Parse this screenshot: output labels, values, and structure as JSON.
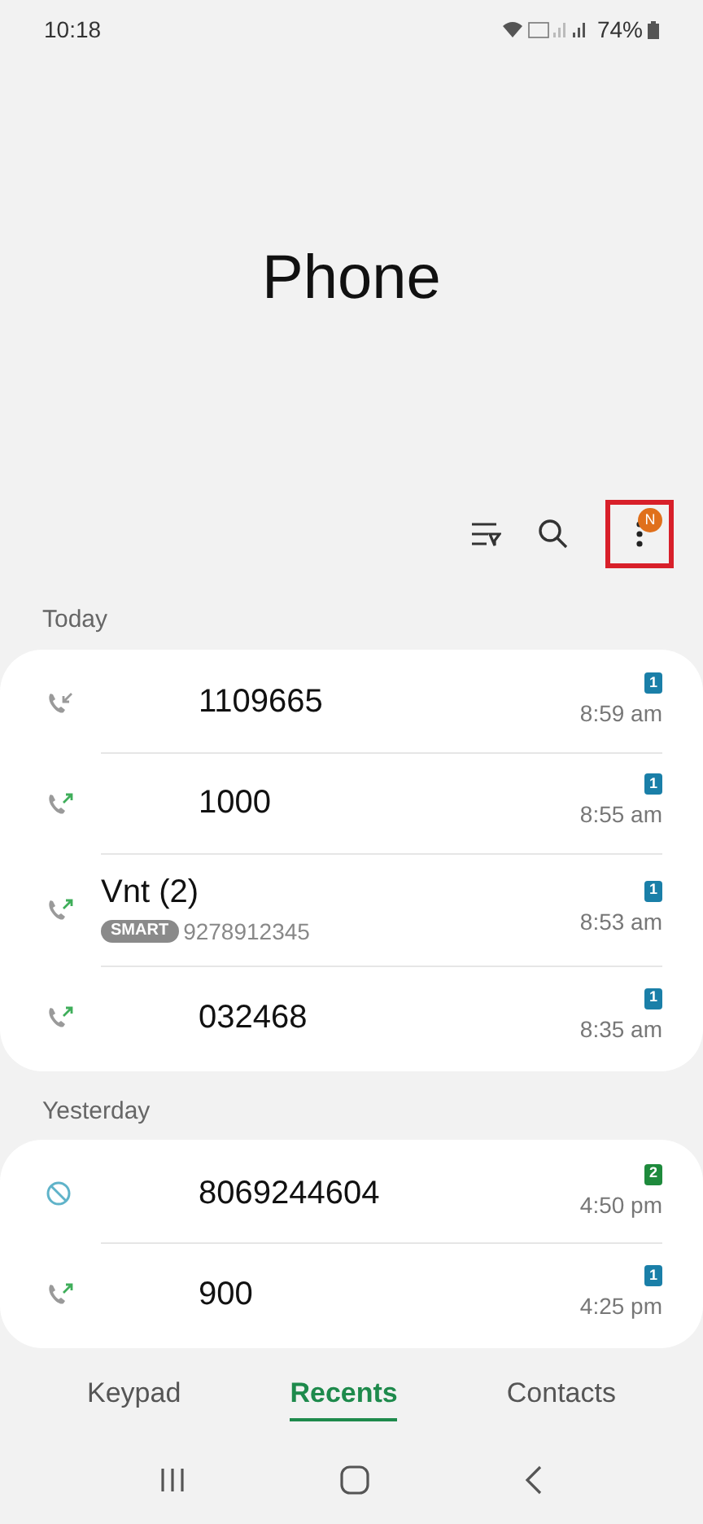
{
  "status_bar": {
    "time": "10:18",
    "battery": "74%"
  },
  "title": "Phone",
  "toolbar": {
    "more_badge": "N"
  },
  "sections": [
    {
      "label": "Today",
      "calls": [
        {
          "kind": "incoming",
          "number": "1109665",
          "sim": "1",
          "color": "#1a7fa8",
          "time": "8:59 am"
        },
        {
          "kind": "outgoing",
          "number": "1000",
          "sim": "1",
          "color": "#1a7fa8",
          "time": "8:55 am"
        },
        {
          "kind": "outgoing",
          "number": "Vnt (2)",
          "tag": "SMART",
          "detail": "9278912345",
          "sim": "1",
          "color": "#1a7fa8",
          "time": "8:53 am"
        },
        {
          "kind": "outgoing",
          "number": "032468",
          "sim": "1",
          "color": "#1a7fa8",
          "time": "8:35 am"
        }
      ]
    },
    {
      "label": "Yesterday",
      "calls": [
        {
          "kind": "blocked",
          "number": "8069244604",
          "sim": "2",
          "color": "#1e8a3c",
          "time": "4:50 pm"
        },
        {
          "kind": "outgoing",
          "number": "900",
          "sim": "1",
          "color": "#1a7fa8",
          "time": "4:25 pm"
        }
      ]
    }
  ],
  "tabs": [
    {
      "label": "Keypad",
      "selected": false
    },
    {
      "label": "Recents",
      "selected": true
    },
    {
      "label": "Contacts",
      "selected": false
    }
  ]
}
